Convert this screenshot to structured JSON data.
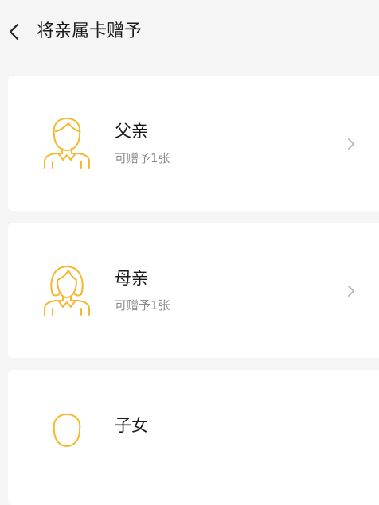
{
  "header": {
    "title": "将亲属卡赠予",
    "back_icon": "chevron-left-icon"
  },
  "accent_color": "#F5B82E",
  "relatives": [
    {
      "name": "父亲",
      "quota": "可赠予1张",
      "icon": "male-avatar-icon"
    },
    {
      "name": "母亲",
      "quota": "可赠予1张",
      "icon": "female-avatar-icon"
    },
    {
      "name": "子女",
      "icon": "child-avatar-icon"
    }
  ]
}
